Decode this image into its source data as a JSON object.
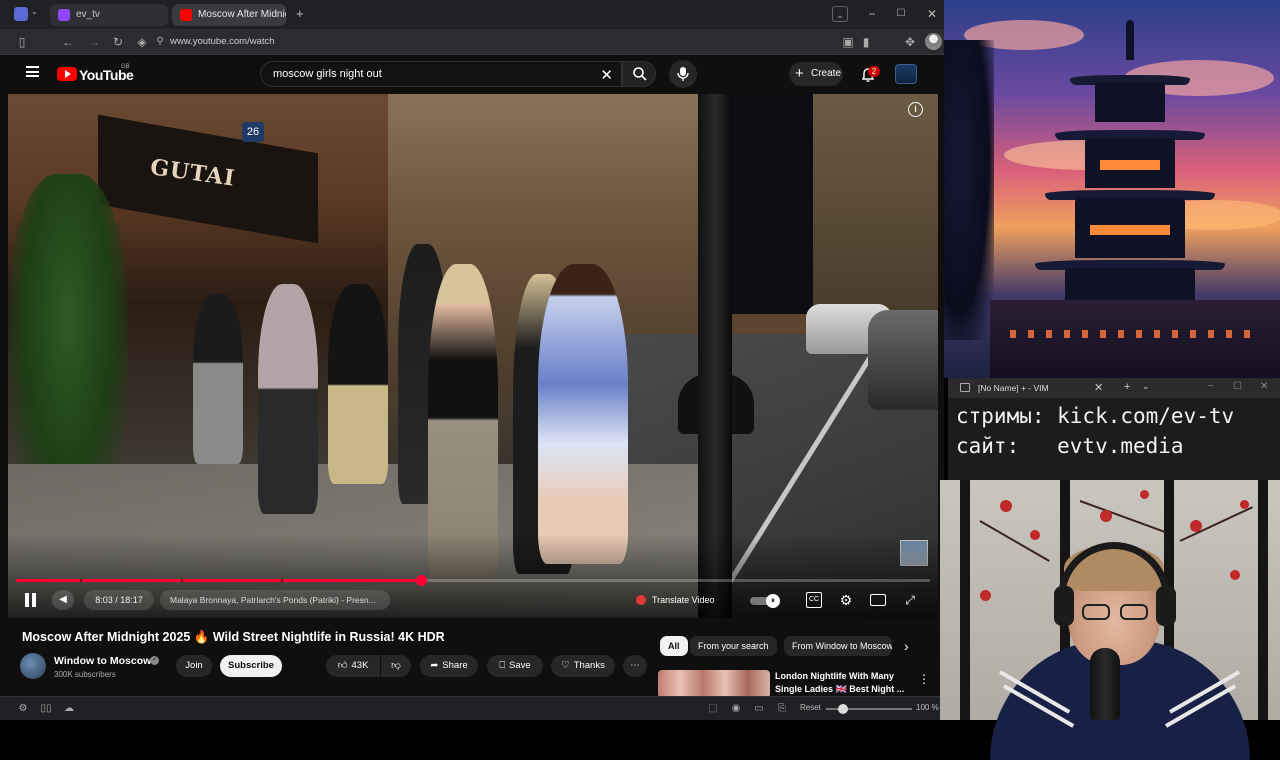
{
  "browser": {
    "tabs": [
      {
        "label": "ev_tv",
        "active": false
      },
      {
        "label": "Moscow After Midnight",
        "active": true
      }
    ],
    "url": "www.youtube.com/watch",
    "window_controls": [
      "chevron-down-icon",
      "minimize-icon",
      "maximize-icon",
      "close-icon"
    ]
  },
  "youtube": {
    "logo_text": "YouTube",
    "logo_country": "GB",
    "search_query": "moscow girls night out",
    "create_label": "Create",
    "notification_count": "2"
  },
  "video_scene": {
    "sign_text": "GUTAI",
    "house_number": "26"
  },
  "player": {
    "progress_fraction": 0.4434,
    "chapter_breaks": [
      0.07,
      0.18,
      0.29
    ],
    "time": "8:03 / 18:17",
    "chapter": "Malaya Bronnaya, Patriarch's Ponds (Patriki) - Presn...",
    "translate_label": "Translate Video"
  },
  "video_info": {
    "title": "Moscow After Midnight 2025 🔥 Wild Street Nightlife in Russia! 4K HDR",
    "channel_name": "Window to Moscow",
    "subscribers": "300K subscribers",
    "join_label": "Join",
    "subscribe_label": "Subscribe",
    "like_count": "43K",
    "share_label": "Share",
    "save_label": "Save",
    "thanks_label": "Thanks"
  },
  "recommendations": {
    "chips": [
      "All",
      "From your search",
      "From Window to Moscow"
    ],
    "item_title": "London Nightlife With Many Single Ladies 🇬🇧 Best Night ..."
  },
  "statusbar": {
    "zoom_reset_label": "Reset",
    "zoom_value": "100 %",
    "zoom_fraction": 0.2
  },
  "vim": {
    "window_title": "[No Name] + - VIM",
    "line1": "стримы: kick.com/ev-tv",
    "line2": "сайт:   evtv.media"
  },
  "colors": {
    "youtube_red": "#ff0000",
    "progress_red": "#ff0033",
    "background": "#0f0f0f"
  }
}
